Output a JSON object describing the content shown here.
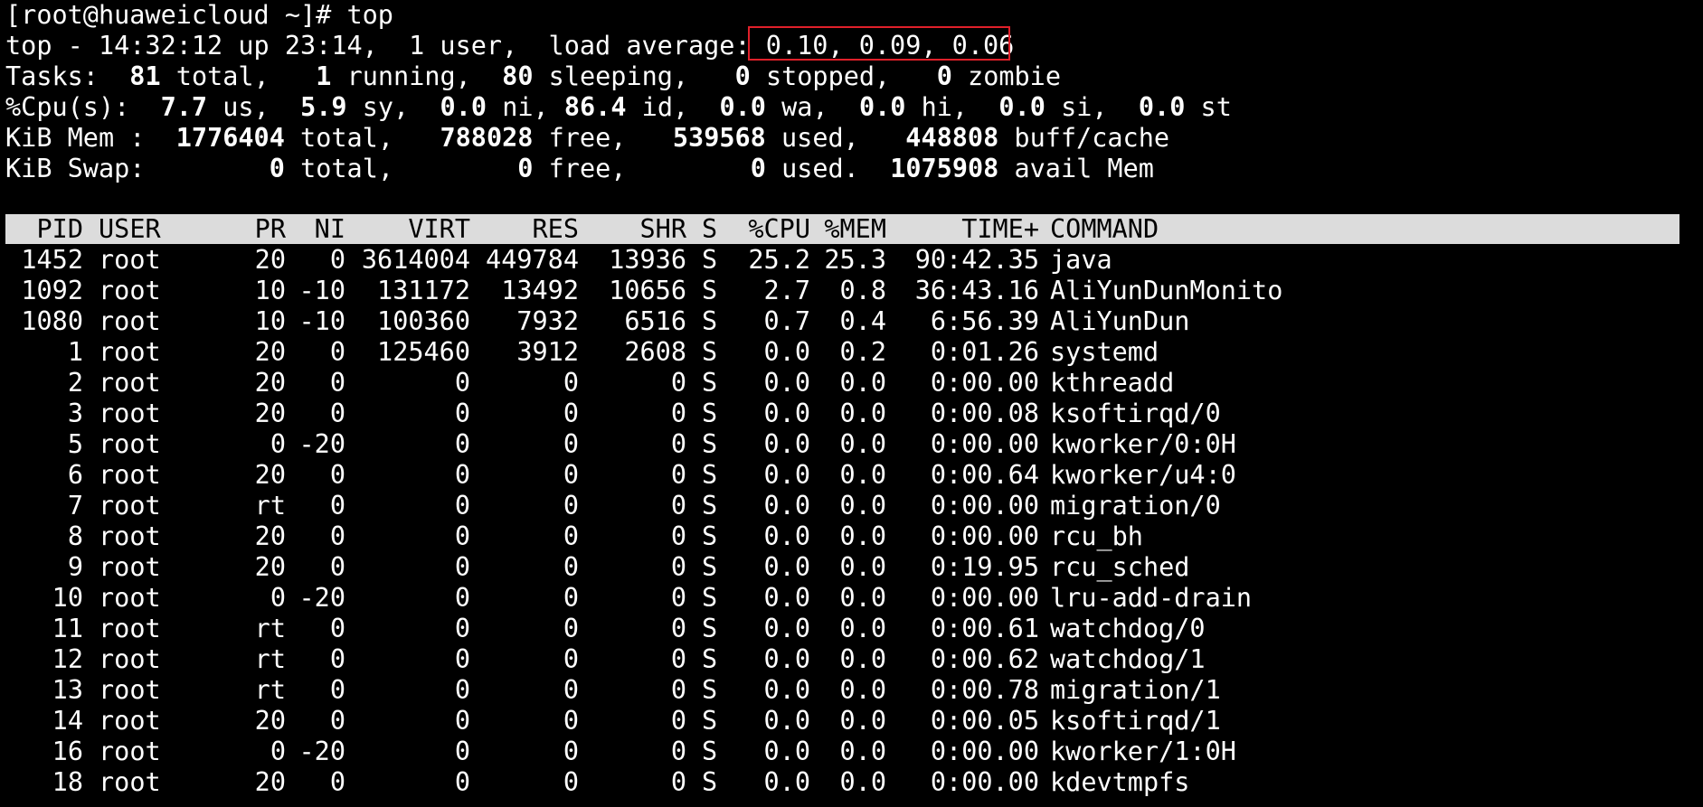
{
  "prompt_line": "[root@huaweicloud ~]# top",
  "summary": {
    "top_prefix": "top - 14:32:12 up 23:14,  1 user,  load average: ",
    "load_average": "0.10, 0.09, 0.06",
    "tasks": {
      "label": "Tasks:",
      "total": "81",
      "total_label": "total,",
      "running": "1",
      "running_label": "running,",
      "sleeping": "80",
      "sleeping_label": "sleeping,",
      "stopped": "0",
      "stopped_label": "stopped,",
      "zombie": "0",
      "zombie_label": "zombie"
    },
    "cpu": {
      "label": "%Cpu(s):",
      "us": "7.7",
      "us_label": "us,",
      "sy": "5.9",
      "sy_label": "sy,",
      "ni": "0.0",
      "ni_label": "ni,",
      "id": "86.4",
      "id_label": "id,",
      "wa": "0.0",
      "wa_label": "wa,",
      "hi": "0.0",
      "hi_label": "hi,",
      "si": "0.0",
      "si_label": "si,",
      "st": "0.0",
      "st_label": "st"
    },
    "mem": {
      "label": "KiB Mem :",
      "total": "1776404",
      "total_label": "total,",
      "free": "788028",
      "free_label": "free,",
      "used": "539568",
      "used_label": "used,",
      "buff": "448808",
      "buff_label": "buff/cache"
    },
    "swap": {
      "label": "KiB Swap:",
      "total": "0",
      "total_label": "total,",
      "free": "0",
      "free_label": "free,",
      "used": "0",
      "used_label": "used.",
      "avail": "1075908",
      "avail_label": "avail Mem"
    }
  },
  "columns": [
    "PID",
    "USER",
    "PR",
    "NI",
    "VIRT",
    "RES",
    "SHR",
    "S",
    "%CPU",
    "%MEM",
    "TIME+",
    "COMMAND"
  ],
  "processes": [
    [
      "1452",
      "root",
      "20",
      "0",
      "3614004",
      "449784",
      "13936",
      "S",
      "25.2",
      "25.3",
      "90:42.35",
      "java"
    ],
    [
      "1092",
      "root",
      "10",
      "-10",
      "131172",
      "13492",
      "10656",
      "S",
      "2.7",
      "0.8",
      "36:43.16",
      "AliYunDunMonito"
    ],
    [
      "1080",
      "root",
      "10",
      "-10",
      "100360",
      "7932",
      "6516",
      "S",
      "0.7",
      "0.4",
      "6:56.39",
      "AliYunDun"
    ],
    [
      "1",
      "root",
      "20",
      "0",
      "125460",
      "3912",
      "2608",
      "S",
      "0.0",
      "0.2",
      "0:01.26",
      "systemd"
    ],
    [
      "2",
      "root",
      "20",
      "0",
      "0",
      "0",
      "0",
      "S",
      "0.0",
      "0.0",
      "0:00.00",
      "kthreadd"
    ],
    [
      "3",
      "root",
      "20",
      "0",
      "0",
      "0",
      "0",
      "S",
      "0.0",
      "0.0",
      "0:00.08",
      "ksoftirqd/0"
    ],
    [
      "5",
      "root",
      "0",
      "-20",
      "0",
      "0",
      "0",
      "S",
      "0.0",
      "0.0",
      "0:00.00",
      "kworker/0:0H"
    ],
    [
      "6",
      "root",
      "20",
      "0",
      "0",
      "0",
      "0",
      "S",
      "0.0",
      "0.0",
      "0:00.64",
      "kworker/u4:0"
    ],
    [
      "7",
      "root",
      "rt",
      "0",
      "0",
      "0",
      "0",
      "S",
      "0.0",
      "0.0",
      "0:00.00",
      "migration/0"
    ],
    [
      "8",
      "root",
      "20",
      "0",
      "0",
      "0",
      "0",
      "S",
      "0.0",
      "0.0",
      "0:00.00",
      "rcu_bh"
    ],
    [
      "9",
      "root",
      "20",
      "0",
      "0",
      "0",
      "0",
      "S",
      "0.0",
      "0.0",
      "0:19.95",
      "rcu_sched"
    ],
    [
      "10",
      "root",
      "0",
      "-20",
      "0",
      "0",
      "0",
      "S",
      "0.0",
      "0.0",
      "0:00.00",
      "lru-add-drain"
    ],
    [
      "11",
      "root",
      "rt",
      "0",
      "0",
      "0",
      "0",
      "S",
      "0.0",
      "0.0",
      "0:00.61",
      "watchdog/0"
    ],
    [
      "12",
      "root",
      "rt",
      "0",
      "0",
      "0",
      "0",
      "S",
      "0.0",
      "0.0",
      "0:00.62",
      "watchdog/1"
    ],
    [
      "13",
      "root",
      "rt",
      "0",
      "0",
      "0",
      "0",
      "S",
      "0.0",
      "0.0",
      "0:00.78",
      "migration/1"
    ],
    [
      "14",
      "root",
      "20",
      "0",
      "0",
      "0",
      "0",
      "S",
      "0.0",
      "0.0",
      "0:00.05",
      "ksoftirqd/1"
    ],
    [
      "16",
      "root",
      "0",
      "-20",
      "0",
      "0",
      "0",
      "S",
      "0.0",
      "0.0",
      "0:00.00",
      "kworker/1:0H"
    ],
    [
      "18",
      "root",
      "20",
      "0",
      "0",
      "0",
      "0",
      "S",
      "0.0",
      "0.0",
      "0:00.00",
      "kdevtmpfs"
    ]
  ],
  "colors": {
    "background": "#000000",
    "text": "#ffffff",
    "header_bar": "#dcdcdc",
    "highlight_box": "#e0202a"
  }
}
